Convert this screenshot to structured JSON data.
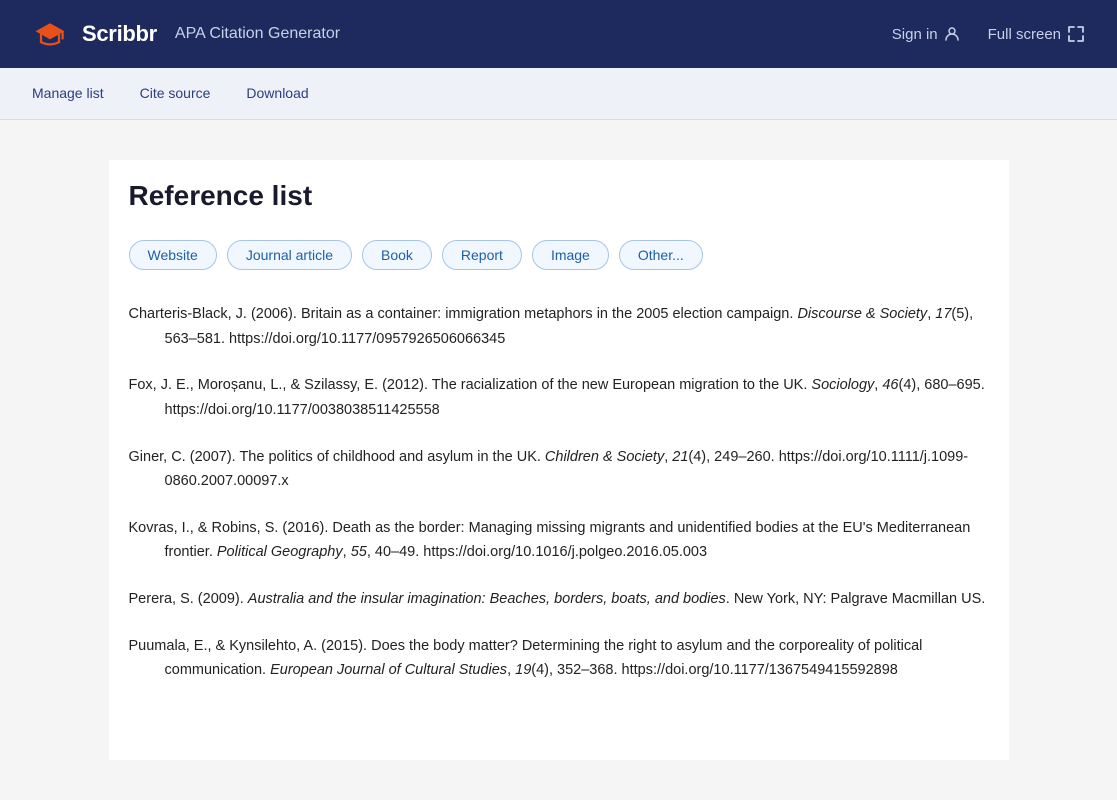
{
  "header": {
    "logo_text": "Scribbr",
    "app_name": "APA Citation Generator",
    "sign_in_label": "Sign in",
    "fullscreen_label": "Full screen"
  },
  "navbar": {
    "items": [
      {
        "id": "manage-list",
        "label": "Manage list"
      },
      {
        "id": "cite-source",
        "label": "Cite source"
      },
      {
        "id": "download",
        "label": "Download"
      }
    ]
  },
  "main": {
    "page_title": "Reference list",
    "source_types": [
      {
        "id": "website",
        "label": "Website"
      },
      {
        "id": "journal-article",
        "label": "Journal article"
      },
      {
        "id": "book",
        "label": "Book"
      },
      {
        "id": "report",
        "label": "Report"
      },
      {
        "id": "image",
        "label": "Image"
      },
      {
        "id": "other",
        "label": "Other..."
      }
    ],
    "references": [
      {
        "id": "ref1",
        "text": "Charteris-Black, J. (2006). Britain as a container: immigration metaphors in the 2005 election campaign.",
        "italic_part": "Discourse & Society",
        "after_italic": ", 17(5), 563–581. https://doi.org/10.1177/0957926506066345"
      },
      {
        "id": "ref2",
        "text": "Fox, J. E., Moroșanu, L., & Szilassy, E. (2012). The racialization of the new European migration to the UK.",
        "italic_part": "Sociology",
        "after_italic": ", 46(4), 680–695. https://doi.org/10.1177/0038038511425558"
      },
      {
        "id": "ref3",
        "text": "Giner, C. (2007). The politics of childhood and asylum in the UK.",
        "italic_part": "Children & Society",
        "after_italic": ", 21(4), 249–260. https://doi.org/10.1111/j.1099-0860.2007.00097.x"
      },
      {
        "id": "ref4",
        "text": "Kovras, I., & Robins, S. (2016). Death as the border: Managing missing migrants and unidentified bodies at the EU's Mediterranean frontier.",
        "italic_part": "Political Geography",
        "after_italic": ", 55, 40–49. https://doi.org/10.1016/j.polgeo.2016.05.003"
      },
      {
        "id": "ref5",
        "text": "Perera, S. (2009).",
        "italic_part": "Australia and the insular imagination: Beaches, borders, boats, and bodies",
        "after_italic": ". New York, NY: Palgrave Macmillan US."
      },
      {
        "id": "ref6",
        "text": "Puumala, E., & Kynsilehto, A. (2015). Does the body matter? Determining the right to asylum and the corporeality of political communication.",
        "italic_part": "European Journal of Cultural Studies",
        "after_italic": ", 19(4), 352–368. https://doi.org/10.1177/1367549415592898"
      }
    ]
  }
}
